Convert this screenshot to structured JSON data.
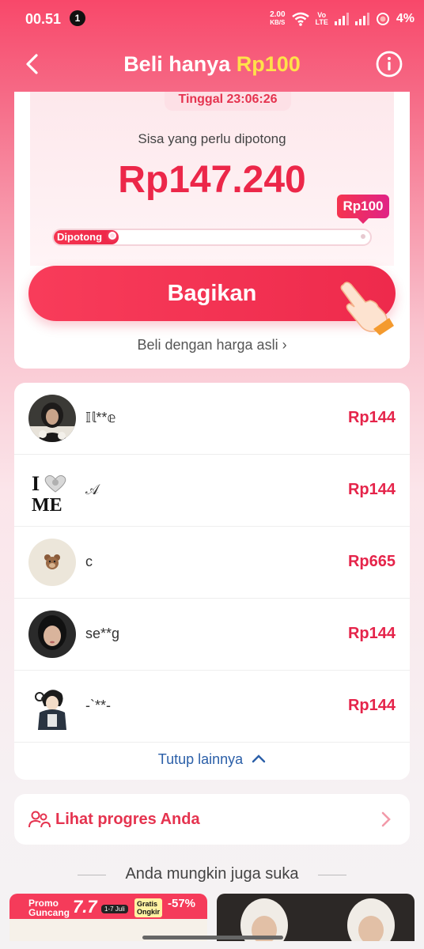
{
  "status_bar": {
    "time": "00.51",
    "notification_count": "1",
    "net_speed_value": "2.00",
    "net_speed_unit": "KB/S",
    "volte_top": "Vo",
    "volte_bottom": "LTE",
    "battery": "4%"
  },
  "header": {
    "title_prefix": "Beli hanya ",
    "title_price": "Rp100"
  },
  "deal": {
    "timer": "Tinggal 23:06:26",
    "remaining_label": "Sisa yang perlu dipotong",
    "remaining_amount": "Rp147.240",
    "target_price": "Rp100",
    "progress_label": "Dipotong",
    "progress_fraction": 0.002,
    "share_label": "Bagikan",
    "buy_original_label": "Beli dengan harga asli ›"
  },
  "friends": [
    {
      "name": "𝕀𝕝**𝕖",
      "amount": "Rp144",
      "avatar_icon": "woman-hijab-avatar-icon"
    },
    {
      "name": "𝒜",
      "amount": "Rp144",
      "avatar_icon": "i-love-me-avatar-icon"
    },
    {
      "name": "c",
      "amount": "Rp665",
      "avatar_icon": "teddy-bear-avatar-icon"
    },
    {
      "name": "se**g",
      "amount": "Rp144",
      "avatar_icon": "woman-portrait-avatar-icon"
    },
    {
      "name": "-`**-",
      "amount": "Rp144",
      "avatar_icon": "anime-boy-avatar-icon"
    }
  ],
  "collapse_label": "Tutup lainnya",
  "progress_card": {
    "label": "Lihat progres Anda"
  },
  "recommendations": {
    "title": "Anda mungkin juga suka",
    "promo_text_1": "Promo",
    "promo_text_2": "Guncang",
    "promo_number": "7.7",
    "promo_date": "1-7 Juli",
    "promo_free_1": "Gratis",
    "promo_free_2": "Ongkir",
    "promo_discount": "-57%"
  },
  "colors": {
    "brand": "#f8486a",
    "accent_yellow": "#ffe14a",
    "price_red": "#e5244a",
    "link_blue": "#2b5fa8"
  }
}
